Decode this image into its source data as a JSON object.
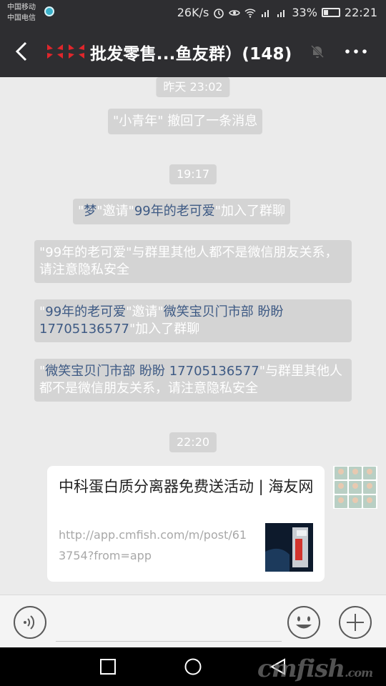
{
  "status_bar": {
    "carrier_1": "中国移动",
    "carrier_2": "中国电信",
    "speed": "26K/s",
    "battery": "33%",
    "time": "22:21"
  },
  "header": {
    "title": "批发零售...鱼友群）(148)"
  },
  "messages": {
    "time_1": "昨天 23:02",
    "recall": "\"小青年\" 撤回了一条消息",
    "time_2": "19:17",
    "invite_1": {
      "q1": "\"",
      "inviter": "梦",
      "mid": "\"邀请\"",
      "invitee": "99年的老可爱",
      "end": "\"加入了群聊"
    },
    "notice_1": "\"99年的老可爱\"与群里其他人都不是微信朋友关系，请注意隐私安全",
    "invite_2": {
      "q1": "\"",
      "inviter": "99年的老可爱",
      "mid": "\"邀请\"",
      "invitee": "微笑宝贝门市部 盼盼 17705136577",
      "end": "\"加入了群聊"
    },
    "notice_2": {
      "q1": "\"",
      "name": "微笑宝贝门市部 盼盼 17705136577",
      "rest": "\"与群里其他人都不是微信朋友关系，请注意隐私安全"
    },
    "time_3": "22:20"
  },
  "link_card": {
    "title": "中科蛋白质分离器免费送活动 | 海友网",
    "url": "http://app.cmfish.com/m/post/613754?from=app"
  },
  "input": {
    "placeholder": ""
  },
  "watermark": {
    "main": "cmfish",
    "suffix": ".com"
  },
  "colors": {
    "header_bg": "#2e2e31",
    "chat_bg": "#ebebeb",
    "pill_bg": "#d4d4d4",
    "name_link": "#3e5a84"
  }
}
